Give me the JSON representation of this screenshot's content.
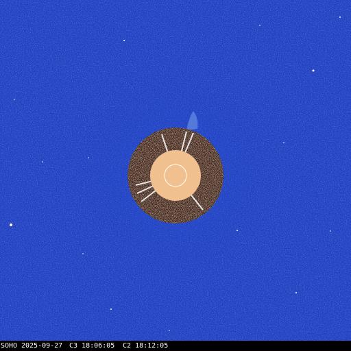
{
  "caption": {
    "observatory": "SOHO",
    "date": "2025-09-27",
    "c3_time": "C3 18:06:05",
    "c2_time": "C2 18:12:05"
  },
  "colors": {
    "field_blue": "#2142c2",
    "occulter_disk": "#f0c08e",
    "sun_outline": "#ffffff",
    "c2_ring_dark": "#3b1d10",
    "c2_ring_light": "#ffffff",
    "caption_bg": "#000000",
    "caption_text": "#ffffff"
  }
}
